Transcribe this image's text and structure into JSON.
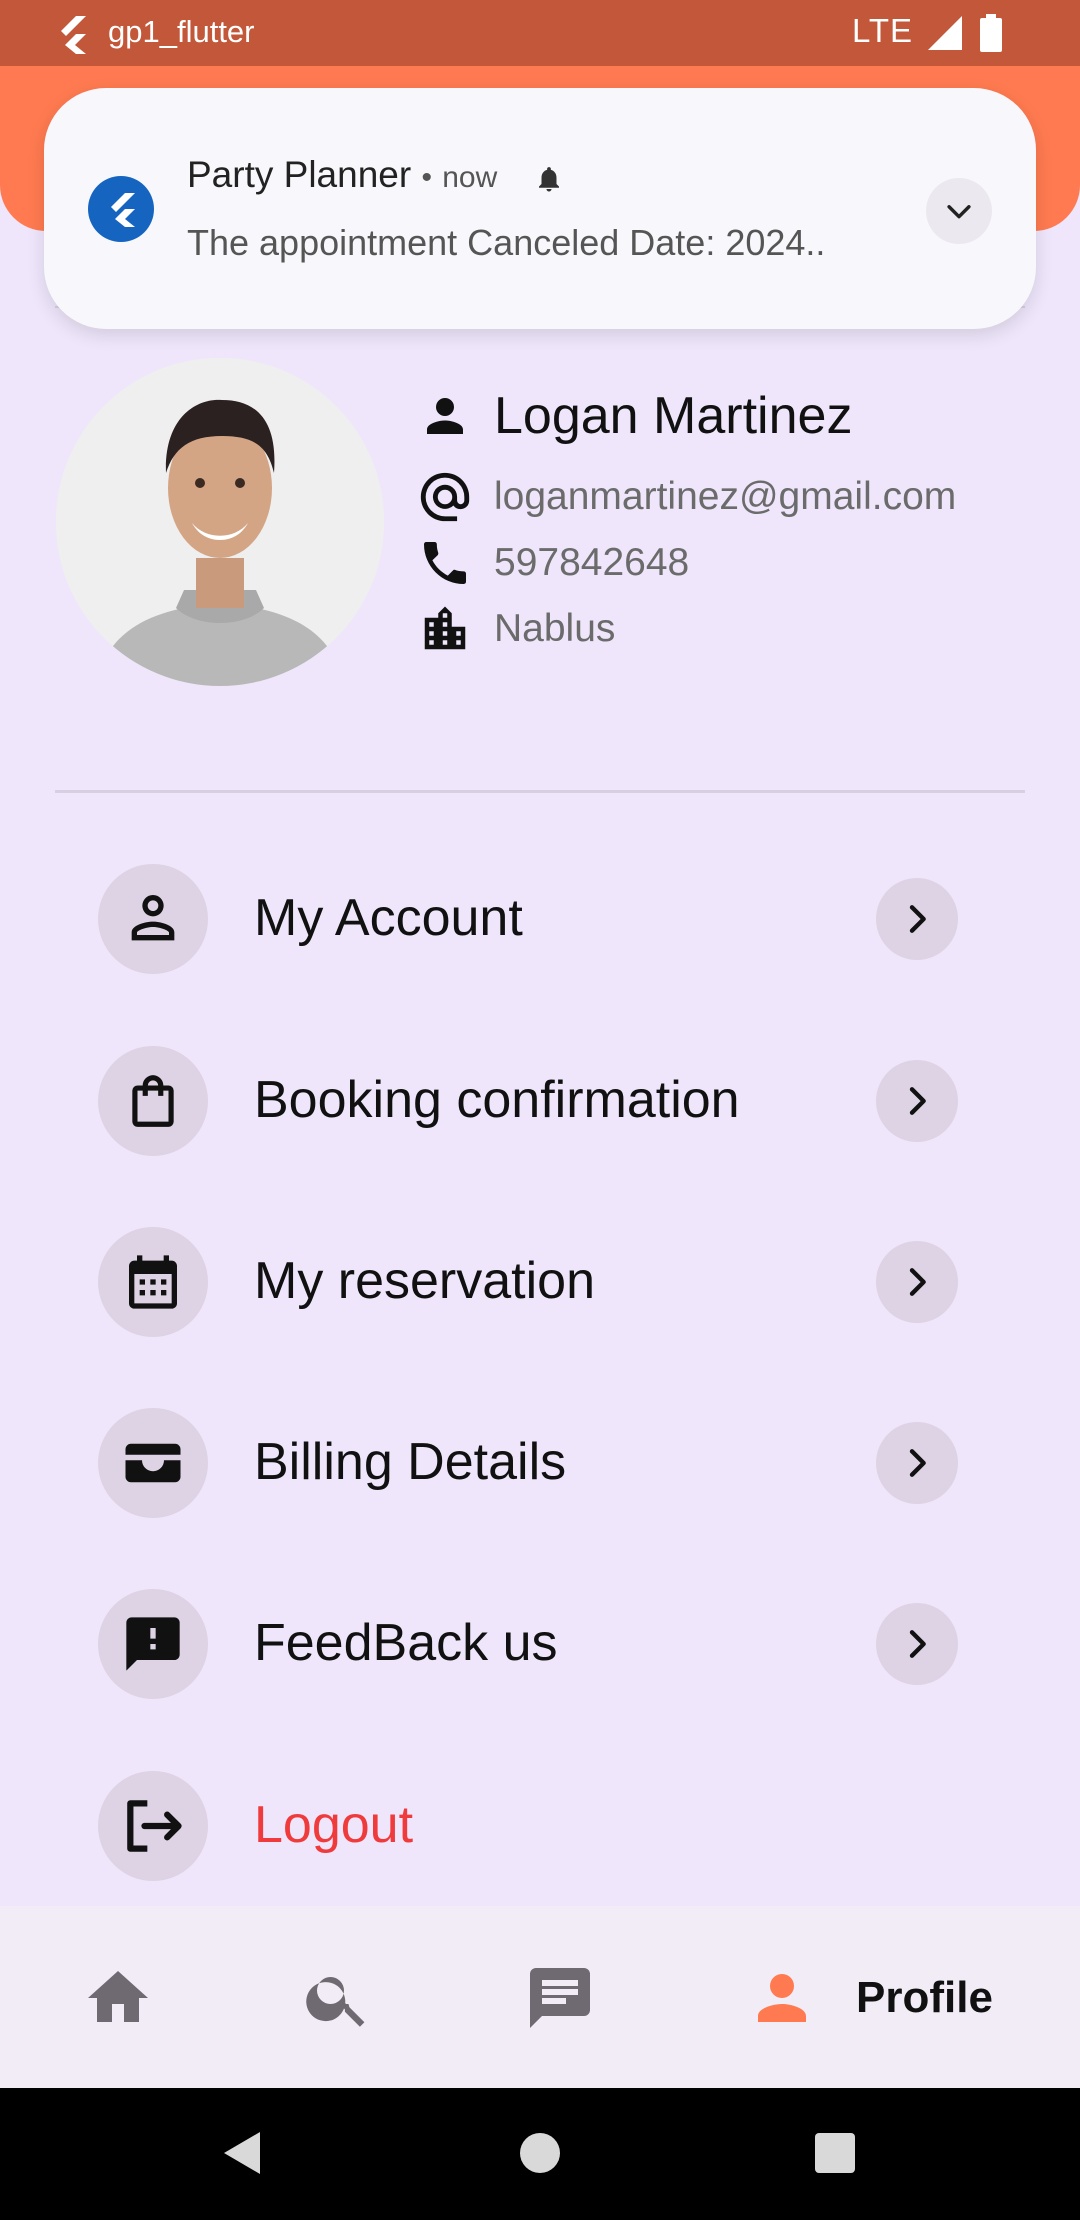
{
  "status_bar": {
    "app_name": "gp1_flutter",
    "network": "LTE"
  },
  "notification": {
    "app": "Party Planner",
    "separator": "•",
    "time": "now",
    "message": "The appointment Canceled  Date: 2024.."
  },
  "profile": {
    "name": "Logan Martinez",
    "email": "loganmartinez@gmail.com",
    "phone": "597842648",
    "city": "Nablus"
  },
  "menu": {
    "items": [
      {
        "label": "My Account",
        "icon": "account-icon"
      },
      {
        "label": "Booking confirmation",
        "icon": "shopping-bag-icon"
      },
      {
        "label": "My reservation",
        "icon": "calendar-icon"
      },
      {
        "label": "Billing Details",
        "icon": "wallet-icon"
      },
      {
        "label": "FeedBack us",
        "icon": "feedback-icon"
      },
      {
        "label": "Logout",
        "icon": "logout-icon"
      }
    ]
  },
  "bottom_nav": {
    "items": [
      "home-icon",
      "search-icon",
      "chat-icon",
      "profile-icon"
    ],
    "active_label": "Profile"
  },
  "colors": {
    "status_bar": "#c2573a",
    "accent": "#ff7a50",
    "background": "#efe6fb",
    "logout": "#ef3b3b"
  }
}
